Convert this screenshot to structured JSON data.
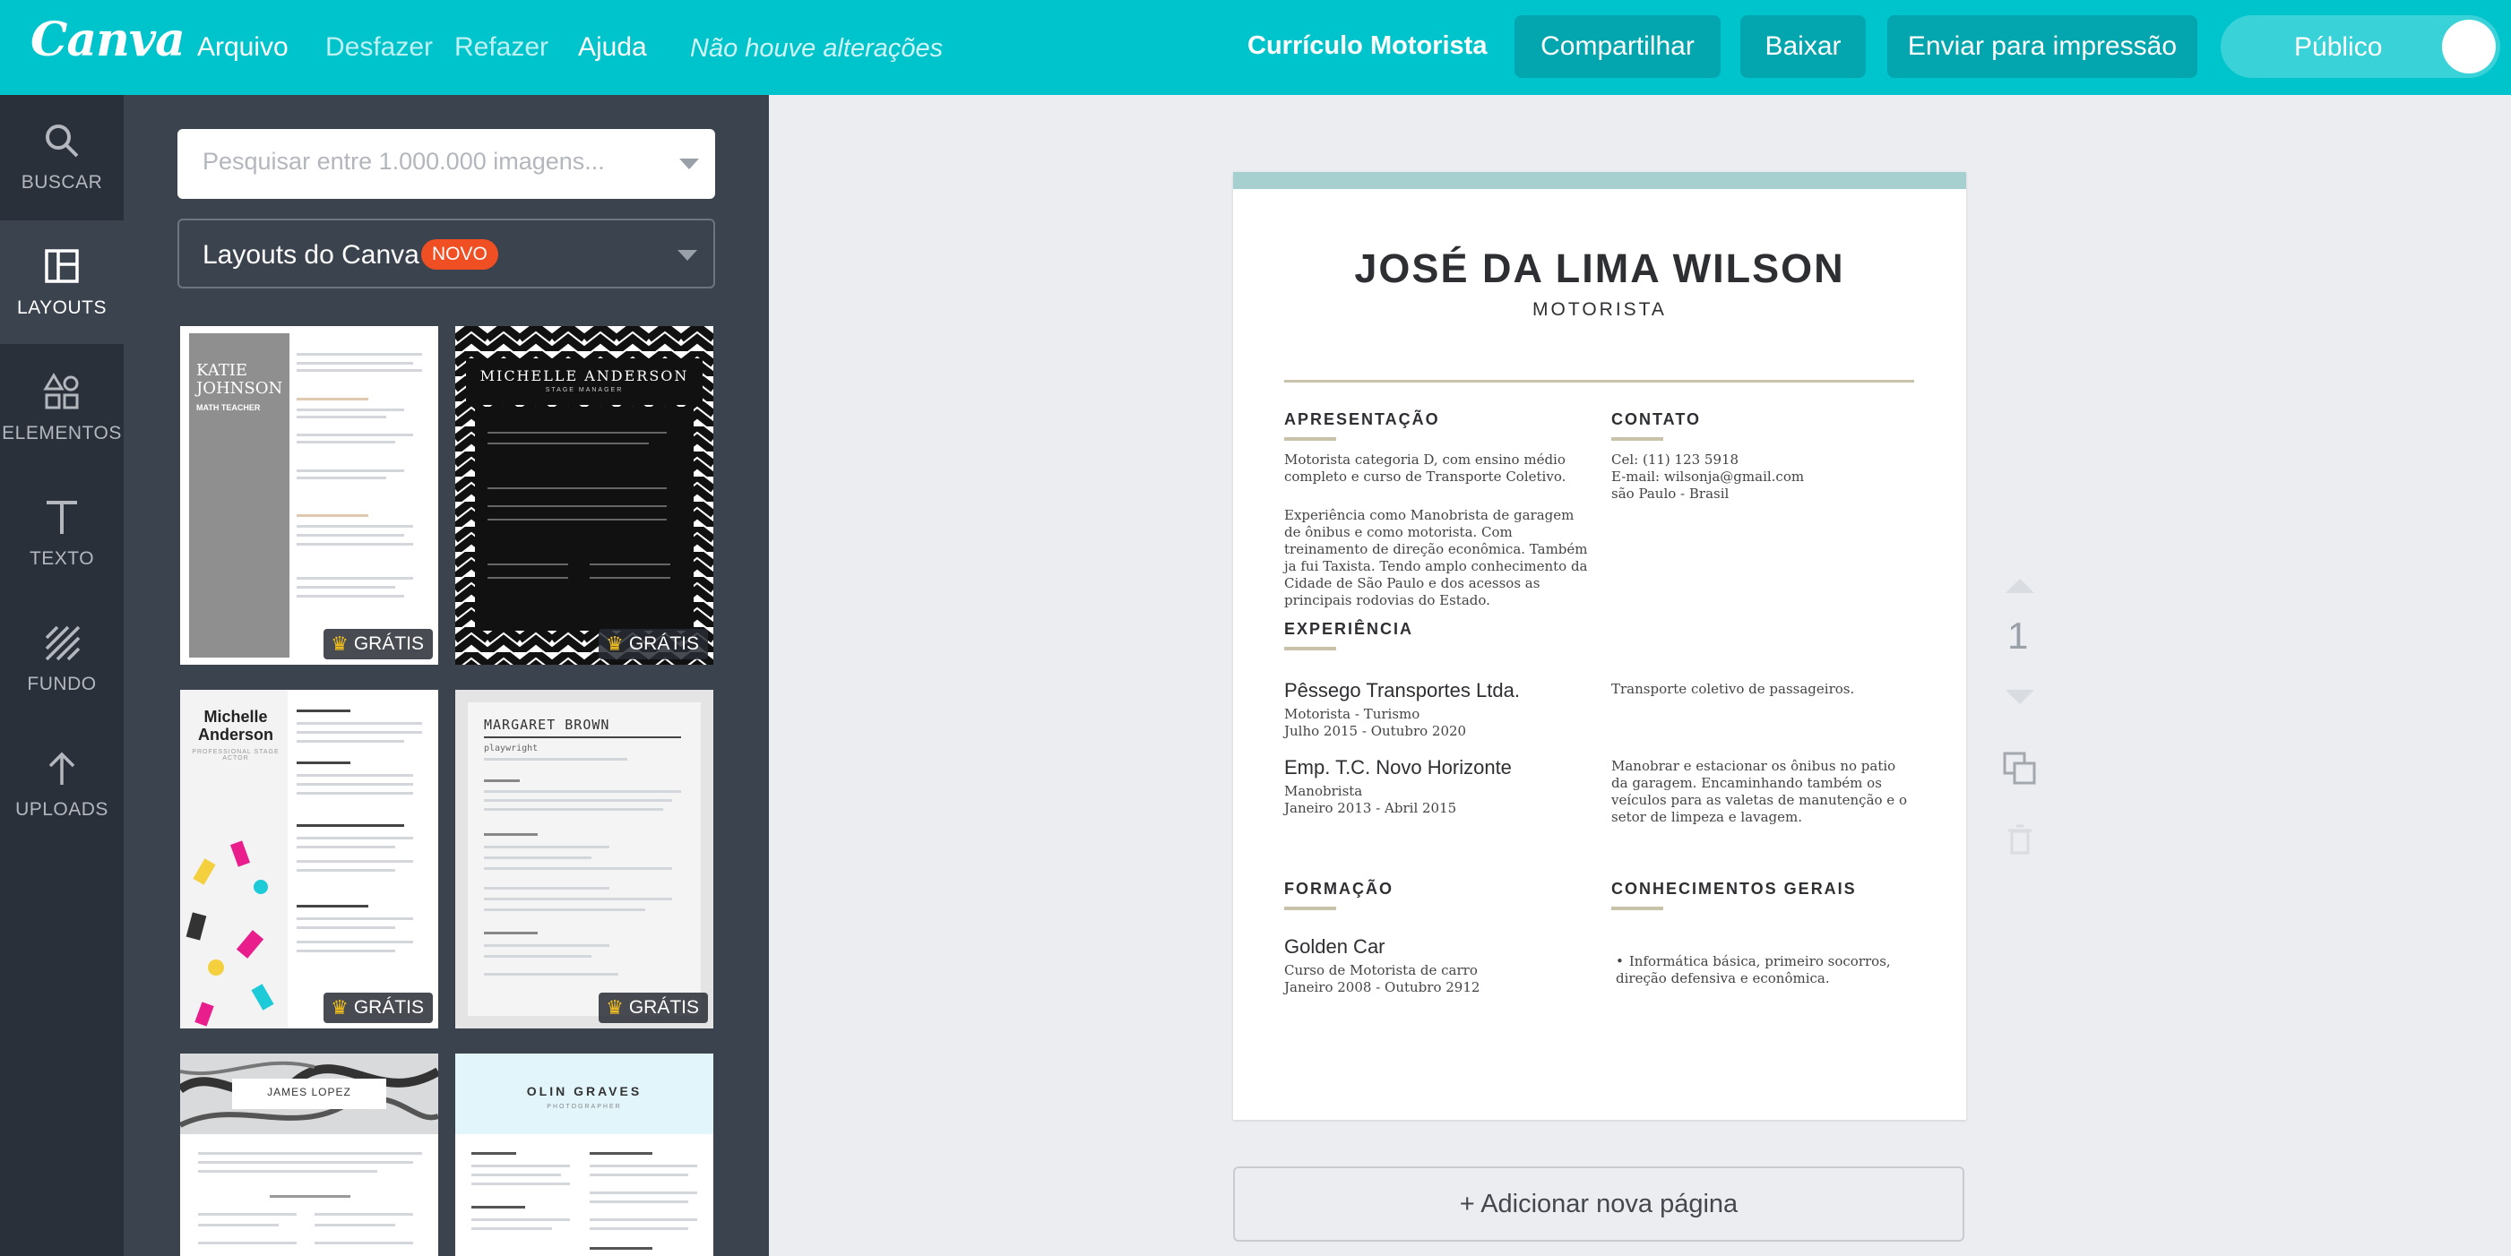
{
  "app": {
    "logo": "Canva",
    "menu": [
      "Arquivo",
      "Desfazer",
      "Refazer",
      "Ajuda"
    ],
    "status": "Não houve alterações",
    "document_title": "Currículo Motorista",
    "buttons": {
      "share": "Compartilhar",
      "download": "Baixar",
      "print": "Enviar para impressão"
    },
    "visibility": "Público",
    "colors": {
      "topbar": "#00c4cc",
      "button": "#03a6ae",
      "rail": "#293039",
      "panel": "#3b434e"
    }
  },
  "rail": {
    "items": [
      {
        "label": "BUSCAR",
        "icon": "search-icon"
      },
      {
        "label": "LAYOUTS",
        "icon": "layouts-icon"
      },
      {
        "label": "ELEMENTOS",
        "icon": "elements-icon"
      },
      {
        "label": "TEXTO",
        "icon": "text-icon"
      },
      {
        "label": "FUNDO",
        "icon": "background-icon"
      },
      {
        "label": "UPLOADS",
        "icon": "upload-icon"
      }
    ],
    "active": "LAYOUTS"
  },
  "panel": {
    "search_placeholder": "Pesquisar entre 1.000.000 imagens...",
    "layout_select": "Layouts do Canva",
    "new_badge": "NOVO",
    "templates": [
      {
        "name": "KATIE JOHNSON",
        "subtitle": "MATH TEACHER",
        "badge": "GRÁTIS"
      },
      {
        "name": "MICHELLE ANDERSON",
        "subtitle": "STAGE MANAGER",
        "badge": "GRÁTIS"
      },
      {
        "name": "Michelle Anderson",
        "subtitle": "PROFESSIONAL STAGE ACTOR",
        "badge": "GRÁTIS"
      },
      {
        "name": "MARGARET BROWN",
        "subtitle": "playwright",
        "badge": "GRÁTIS"
      },
      {
        "name": "JAMES LOPEZ",
        "subtitle": "",
        "badge": ""
      },
      {
        "name": "OLIN GRAVES",
        "subtitle": "PHOTOGRAPHER",
        "badge": ""
      }
    ]
  },
  "resume": {
    "name": "JOSÉ DA LIMA WILSON",
    "role": "MOTORISTA",
    "sections": {
      "summary": {
        "heading": "APRESENTAÇÃO",
        "p1": "Motorista categoria D, com ensino médio completo e curso de Transporte Coletivo.",
        "p2": "Experiência como Manobrista de garagem de ônibus e como motorista. Com treinamento de direção econômica. Também ja fui Taxista. Tendo amplo conhecimento da Cidade de São Paulo e dos acessos as principais rodovias do Estado."
      },
      "contact": {
        "heading": "CONTATO",
        "phone": "Cel: (11) 123 5918",
        "email": "E-mail: wilsonja@gmail.com",
        "location": "são Paulo - Brasil"
      },
      "experience": {
        "heading": "EXPERIÊNCIA",
        "jobs": [
          {
            "company": "Pêssego Transportes Ltda.",
            "role": "Motorista - Turismo",
            "period": "Julho 2015 - Outubro  2020",
            "description": "Transporte coletivo de passageiros."
          },
          {
            "company": "Emp. T.C. Novo Horizonte",
            "role": "Manobrista",
            "period": "Janeiro 2013 - Abril 2015",
            "description": "Manobrar e estacionar os ônibus no patio da garagem. Encaminhando também os veículos para as valetas de manutenção e o setor de limpeza e lavagem."
          }
        ]
      },
      "education": {
        "heading": "FORMAÇÃO",
        "school": "Golden Car",
        "course": "Curso de Motorista de carro",
        "period": "Janeiro  2008 - Outubro  2912"
      },
      "skills": {
        "heading": "CONHECIMENTOS GERAIS",
        "items": [
          "Informática básica, primeiro socorros, direção defensiva e econômica."
        ]
      }
    }
  },
  "canvas": {
    "page_number": "1",
    "add_page": "+ Adicionar nova página"
  }
}
